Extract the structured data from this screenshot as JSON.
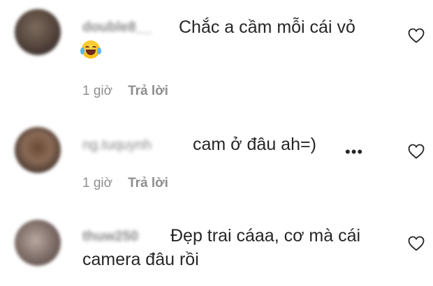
{
  "comments": [
    {
      "username": "double8__",
      "text_line1": "Chắc a cầm mỗi cái vỏ",
      "has_emoji": true,
      "emoji": "joy-emoji",
      "time": "1 giờ",
      "reply_label": "Trả lời"
    },
    {
      "username": "ng.tuquynh",
      "text_line1": "cam ở đâu ah=)",
      "more_label": "•••",
      "time": "1 giờ",
      "reply_label": "Trả lời"
    },
    {
      "username": "thuw250",
      "text_line1": "Đẹp trai cáaa, cơ mà cái",
      "text_line2": "camera đâu rồi"
    }
  ],
  "icons": {
    "like": "heart-outline-icon"
  },
  "colors": {
    "text": "#262626",
    "meta": "#8e8e8e",
    "background": "#ffffff"
  }
}
